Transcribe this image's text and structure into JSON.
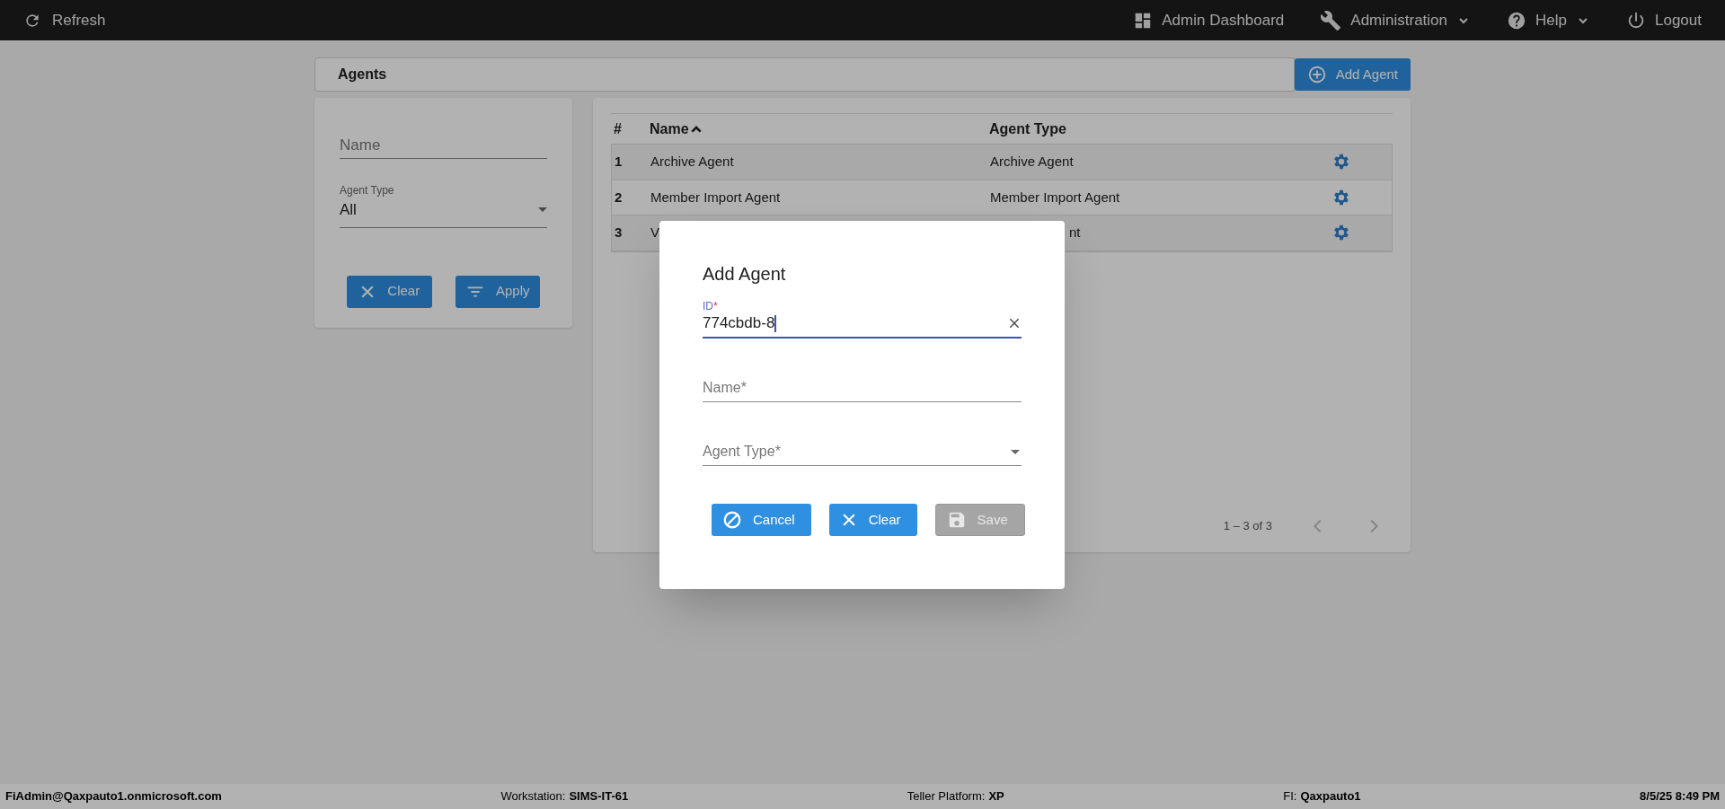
{
  "top_bar": {
    "left": [
      {
        "label": "Refresh"
      }
    ],
    "right": [
      {
        "label": "Admin Dashboard",
        "dropdown": false
      },
      {
        "label": "Administration",
        "dropdown": true
      },
      {
        "label": "Help",
        "dropdown": true
      },
      {
        "label": "Logout",
        "dropdown": false
      }
    ]
  },
  "header": {
    "title": "Agents",
    "button": "Add Agent"
  },
  "filters": {
    "name": {
      "placeholder": "Name"
    },
    "agent_type": {
      "label": "Agent Type",
      "value": "All"
    },
    "buttons": [
      {
        "label": "Clear"
      },
      {
        "label": "Apply"
      }
    ]
  },
  "table": {
    "columns": [
      {
        "label": "#",
        "sorted": false
      },
      {
        "label": "Name",
        "sorted": true
      },
      {
        "label": "Agent Type",
        "sorted": false
      }
    ],
    "rows": [
      {
        "number": "1",
        "name": "Archive Agent",
        "agent_type": "Archive Agent"
      },
      {
        "number": "2",
        "name": "Member Import Agent",
        "agent_type": "Member Import Agent"
      },
      {
        "number": "3",
        "name": "V",
        "agent_type": "nt"
      }
    ],
    "pagination": "1 – 3 of 3"
  },
  "dialog": {
    "title": "Add Agent",
    "fields": [
      {
        "kind": "text",
        "label": "ID",
        "required_mark": "*",
        "value": "774cbdb-8",
        "focused": true
      },
      {
        "kind": "text",
        "label": "Name",
        "required_mark": "*",
        "focused": false
      },
      {
        "kind": "select",
        "label": "Agent Type",
        "required_mark": "*",
        "focused": false
      }
    ],
    "buttons": [
      {
        "label": "Cancel",
        "disabled": false
      },
      {
        "label": "Clear",
        "disabled": false
      },
      {
        "label": "Save",
        "disabled": true
      }
    ]
  },
  "status_bar": [
    {
      "value": "FiAdmin@Qaxpauto1.onmicrosoft.com"
    },
    {
      "label": "Workstation:",
      "value": "SIMS-IT-61"
    },
    {
      "label": "Teller Platform:",
      "value": "XP"
    },
    {
      "label": "FI:",
      "value": "Qaxpauto1"
    },
    {
      "value": "8/5/25 8:49 PM"
    }
  ]
}
